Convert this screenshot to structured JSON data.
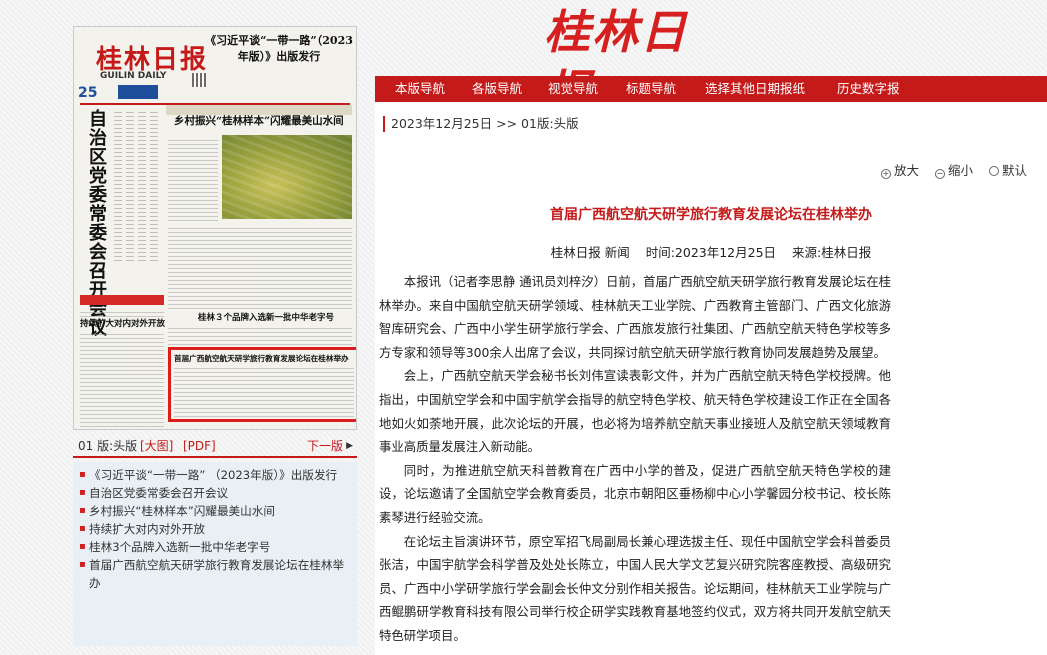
{
  "masthead": {
    "logo_text": "桂林日报"
  },
  "nav": {
    "items": [
      {
        "label": "本版导航"
      },
      {
        "label": "各版导航"
      },
      {
        "label": "视觉导航"
      },
      {
        "label": "标题导航"
      },
      {
        "label": "选择其他日期报纸"
      },
      {
        "label": "历史数字报"
      }
    ]
  },
  "thumbnail": {
    "logo": "桂林日报",
    "logo_en": "GUILIN DAILY",
    "date_number": "25",
    "top_title": "《习近平谈“一带一路”（2023年版）》出版发行",
    "lead_vertical": "自治区党委常委会召开会议",
    "feature_title": "乡村振兴“桂林样本”闪耀最美山水间",
    "item_title_1": "持续扩大对内对外开放",
    "item_title_2": "桂林３个品牌入选新一批中华老字号",
    "item_title_3": "首届广西航空航天研学旅行教育发展论坛在桂林举办"
  },
  "issue": {
    "edition": "01 版:头版",
    "link_big": "[大图]",
    "link_pdf": "[PDF]",
    "next_label": "下一版"
  },
  "articles": [
    {
      "title": "《习近平谈“一带一路” （2023年版）》出版发行"
    },
    {
      "title": "自治区党委常委会召开会议"
    },
    {
      "title": "乡村振兴“桂林样本”闪耀最美山水间"
    },
    {
      "title": "持续扩大对内对外开放"
    },
    {
      "title": "桂林3个品牌入选新一批中华老字号"
    },
    {
      "title": "首届广西航空航天研学旅行教育发展论坛在桂林举办"
    }
  ],
  "breadcrumb": {
    "date": "2023年12月25日",
    "separator": ">>",
    "edition": "01版:头版"
  },
  "zoom": {
    "enlarge": "放大",
    "shrink": "缩小",
    "default": "默认"
  },
  "article": {
    "headline": "首届广西航空航天研学旅行教育发展论坛在桂林举办",
    "source_name": "桂林日报 新闻",
    "time": "时间:2023年12月25日",
    "source": "来源:桂林日报",
    "paragraphs": [
      "本报讯（记者李思静 通讯员刘梓汐）日前，首届广西航空航天研学旅行教育发展论坛在桂林举办。来自中国航空航天研学领域、桂林航天工业学院、广西教育主管部门、广西文化旅游智库研究会、广西中小学生研学旅行学会、广西旅发旅行社集团、广西航空航天特色学校等多方专家和领导等300余人出席了会议，共同探讨航空航天研学旅行教育协同发展趋势及展望。",
      "会上，广西航空航天学会秘书长刘伟宣读表彰文件，并为广西航空航天特色学校授牌。他指出，中国航空学会和中国宇航学会指导的航空特色学校、航天特色学校建设工作正在全国各地如火如荼地开展，此次论坛的开展，也必将为培养航空航天事业接班人及航空航天领域教育事业高质量发展注入新动能。",
      "同时，为推进航空航天科普教育在广西中小学的普及，促进广西航空航天特色学校的建设，论坛邀请了全国航空学会教育委员，北京市朝阳区垂杨柳中心小学馨园分校书记、校长陈素琴进行经验交流。",
      "在论坛主旨演讲环节，原空军招飞局副局长兼心理选拔主任、现任中国航空学会科普委员张洁，中国宇航学会科学普及处处长陈立，中国人民大学文艺复兴研究院客座教授、高级研究员、广西中小学研学旅行学会副会长仲文分别作相关报告。论坛期间，桂林航天工业学院与广西鲲鹏研学教育科技有限公司举行校企研学实践教育基地签约仪式，双方将共同开发航空航天特色研学项目。"
    ]
  }
}
